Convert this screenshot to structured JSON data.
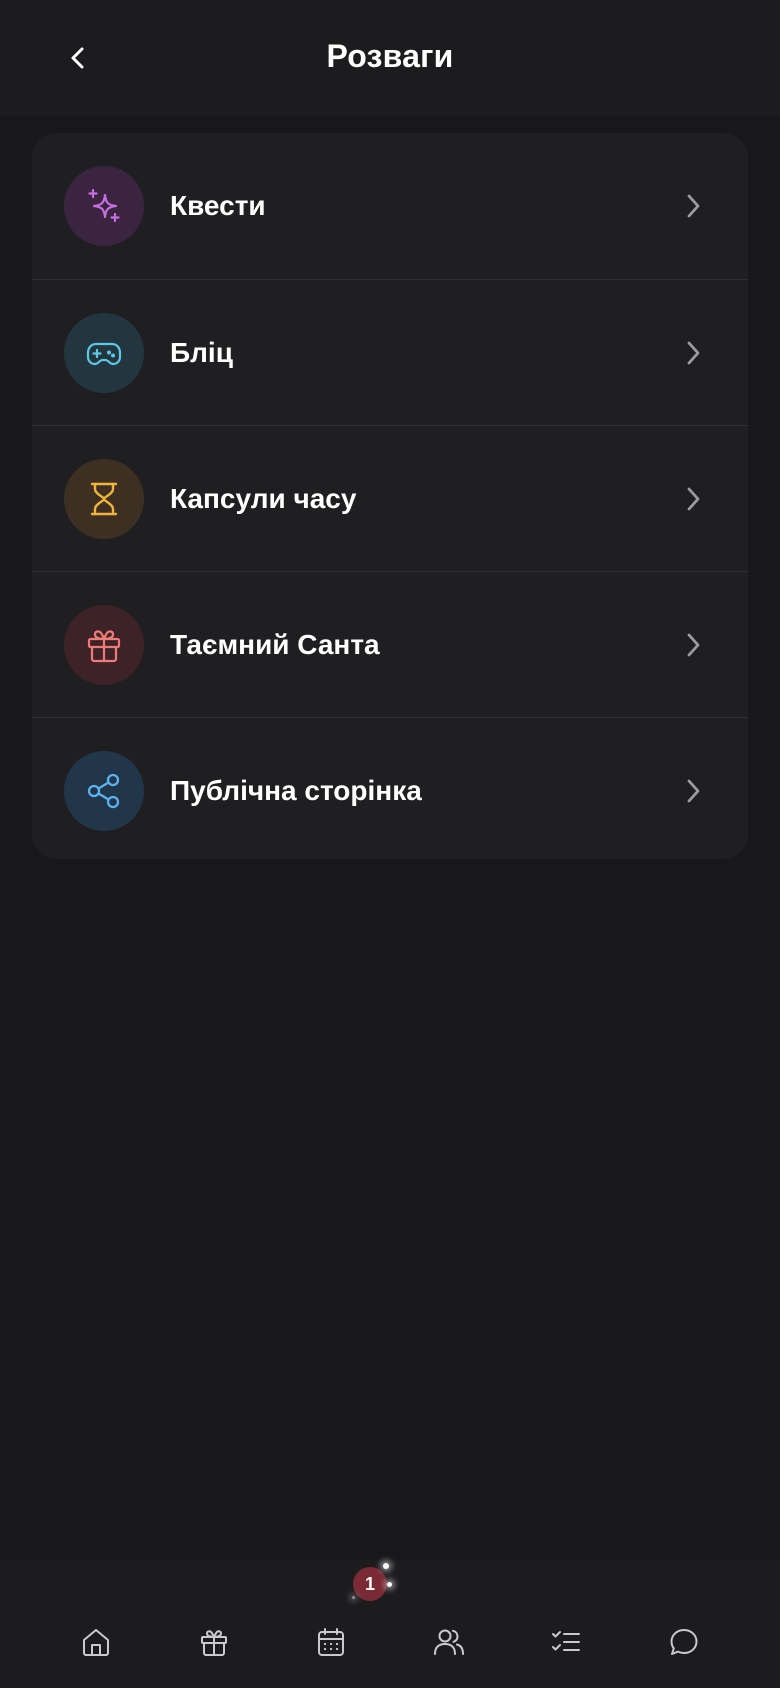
{
  "header": {
    "title": "Розваги",
    "back_icon": "chevron-left-icon"
  },
  "menu": {
    "items": [
      {
        "label": "Квести",
        "icon": "sparkles-icon",
        "icon_color": "#c76ee0",
        "circle_color": "#3b2440"
      },
      {
        "label": "Бліц",
        "icon": "gamepad-icon",
        "icon_color": "#5ec8e4",
        "circle_color": "#233640"
      },
      {
        "label": "Капсули часу",
        "icon": "hourglass-icon",
        "icon_color": "#f0b43c",
        "circle_color": "#3d2f22"
      },
      {
        "label": "Таємний Санта",
        "icon": "gift-icon",
        "icon_color": "#ef7b78",
        "circle_color": "#3d2327"
      },
      {
        "label": "Публічна сторінка",
        "icon": "share-icon",
        "icon_color": "#5ab3f0",
        "circle_color": "#22364a"
      }
    ],
    "chevron_icon": "chevron-right-icon"
  },
  "bottom_nav": {
    "items": [
      {
        "icon": "home-icon"
      },
      {
        "icon": "gift-icon"
      },
      {
        "icon": "calendar-icon"
      },
      {
        "icon": "users-icon"
      },
      {
        "icon": "checklist-icon"
      },
      {
        "icon": "chat-icon"
      }
    ],
    "badge": {
      "count": "1",
      "on_item": "calendar-icon",
      "color": "#7a2a35"
    }
  },
  "colors": {
    "background": "#18181b",
    "card": "#1f1f22",
    "header": "#1c1c1f",
    "nav_icon": "#c9c9ce",
    "chevron": "#9b9ba2"
  }
}
